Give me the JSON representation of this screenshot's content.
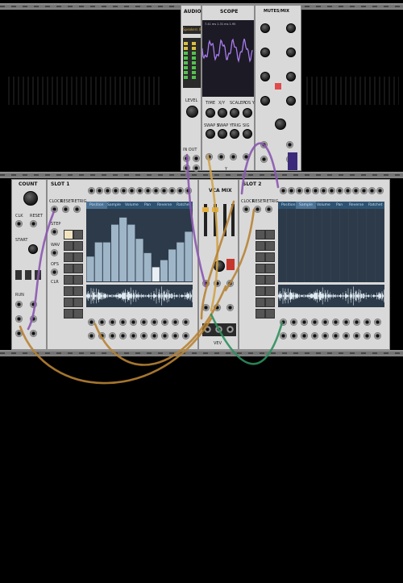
{
  "audio_module": {
    "title": "AUDIO",
    "level_label": "LEVEL",
    "device": "Speakers (R",
    "io_label": "IN  OUT"
  },
  "scope_module": {
    "title": "SCOPE",
    "readout": "7.41 ms   1.31 ms  1.95",
    "labels": [
      "TIME",
      "X/Y",
      "SCALE Y",
      "POS Y",
      "SWAP X",
      "SWAP Y",
      "TRIG",
      "SIG"
    ],
    "y_label": "Y"
  },
  "right_top_module": {
    "title": "MUTES/MIX"
  },
  "left_module": {
    "title": "COUNT",
    "labels": [
      "CLK",
      "RESET",
      "START",
      "RUN"
    ]
  },
  "seq1": {
    "title": "SLOT 1",
    "tabs": [
      "Position",
      "Sample",
      "Volume",
      "Pan",
      "Reverse",
      "Ratchet"
    ],
    "active_tab": 0,
    "jack_labels": [
      "CLOCK",
      "RESET",
      "RETRIG"
    ],
    "side_labels": [
      "STEP",
      "WAV",
      "OFS",
      "CLR"
    ],
    "bar_values": [
      0.35,
      0.55,
      0.55,
      0.8,
      0.9,
      0.8,
      0.6,
      0.4,
      0.2,
      0.3,
      0.45,
      0.55,
      0.7
    ]
  },
  "vca_mix": {
    "title": "VCA MIX",
    "footer": "VEV"
  },
  "seq2": {
    "title": "SLOT 2",
    "tabs": [
      "Position",
      "Sample",
      "Volume",
      "Pan",
      "Reverse",
      "Ratchet"
    ],
    "active_tab": 1,
    "jack_labels": [
      "CLOCK",
      "RESET",
      "RETRIG"
    ]
  },
  "cable_colors": [
    "#b78233",
    "#8a56b0",
    "#2e8f5c",
    "#d0a34a"
  ]
}
